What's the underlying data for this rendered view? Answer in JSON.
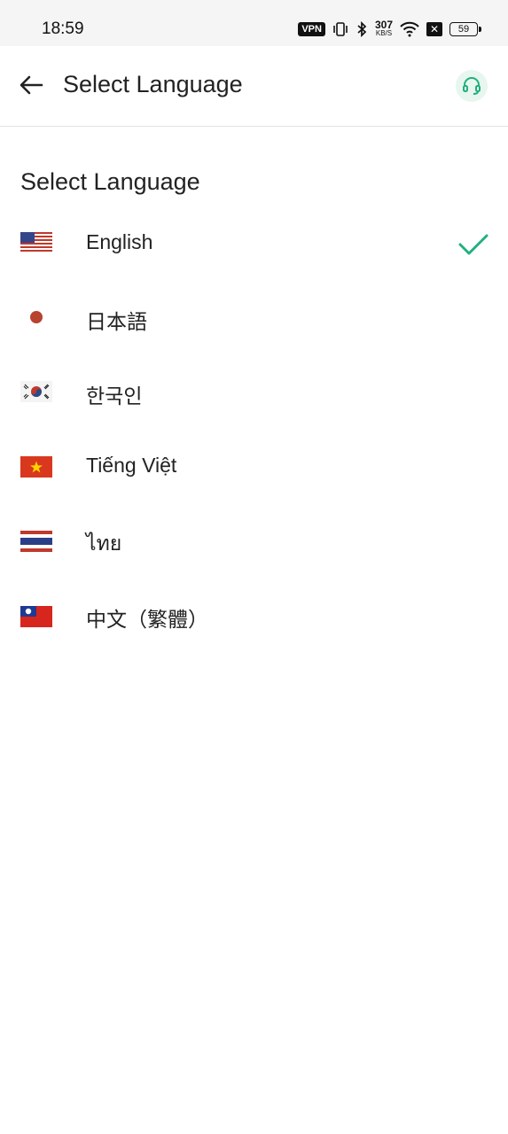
{
  "status_bar": {
    "time": "18:59",
    "vpn_label": "VPN",
    "net_speed_value": "307",
    "net_speed_unit": "KB/S",
    "battery_level": "59"
  },
  "header": {
    "title": "Select Language",
    "back_icon": "arrow-left-icon",
    "support_icon": "headset-icon",
    "accent_color": "#22b07d"
  },
  "section": {
    "title": "Select Language"
  },
  "languages": [
    {
      "label": "English",
      "flag": "us-flag-icon",
      "selected": true
    },
    {
      "label": "日本語",
      "flag": "japan-flag-icon",
      "selected": false
    },
    {
      "label": "한국인",
      "flag": "korea-flag-icon",
      "selected": false
    },
    {
      "label": "Tiếng Việt",
      "flag": "vietnam-flag-icon",
      "selected": false
    },
    {
      "label": "ไทย",
      "flag": "thailand-flag-icon",
      "selected": false
    },
    {
      "label": "中文（繁體）",
      "flag": "taiwan-flag-icon",
      "selected": false
    }
  ]
}
